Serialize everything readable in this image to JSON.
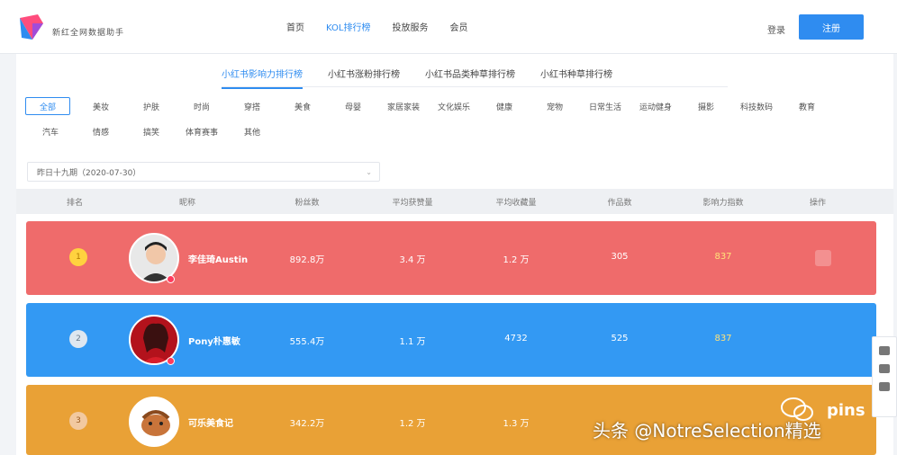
{
  "brand": {
    "name": "新红全网数据助手"
  },
  "nav": {
    "items": [
      "首页",
      "KOL排行榜",
      "投放服务",
      "会员"
    ],
    "active_index": 1
  },
  "auth": {
    "login": "登录",
    "register": "注册"
  },
  "subtabs": {
    "items": [
      "小红书影响力排行榜",
      "小红书涨粉排行榜",
      "小红书品类种草排行榜",
      "小红书种草排行榜"
    ],
    "active_index": 0
  },
  "categories": {
    "items": [
      "全部",
      "美妆",
      "护肤",
      "时尚",
      "穿搭",
      "美食",
      "母婴",
      "家居家装",
      "文化娱乐",
      "健康",
      "宠物",
      "日常生活",
      "运动健身",
      "摄影",
      "科技数码",
      "教育",
      "汽车",
      "情感",
      "搞笑",
      "体育赛事",
      "其他"
    ],
    "active_index": 0
  },
  "date_select": {
    "value": "昨日十九期（2020-07-30）"
  },
  "table": {
    "headers": [
      "排名",
      "昵称",
      "粉丝数",
      "平均获赞量",
      "平均收藏量",
      "作品数",
      "影响力指数",
      "操作"
    ],
    "rows": [
      {
        "name": "李佳琦Austin",
        "fans": "892.8万",
        "avg_like": "3.4 万",
        "avg_collect": "1.2 万",
        "notes": "305",
        "score": "837",
        "color": "#ef6b6b"
      },
      {
        "name": "Pony朴惠敏",
        "fans": "555.4万",
        "avg_like": "1.1 万",
        "avg_collect": "4732",
        "notes": "525",
        "score": "837",
        "color": "#3399f3"
      },
      {
        "name": "可乐美食记",
        "fans": "342.2万",
        "avg_like": "1.2 万",
        "avg_collect": "1.3 万",
        "notes": "",
        "score": "",
        "color": "#e9a136"
      }
    ]
  },
  "watermark": {
    "text": "头条 @NotreSelection精选",
    "badge": "pins"
  }
}
